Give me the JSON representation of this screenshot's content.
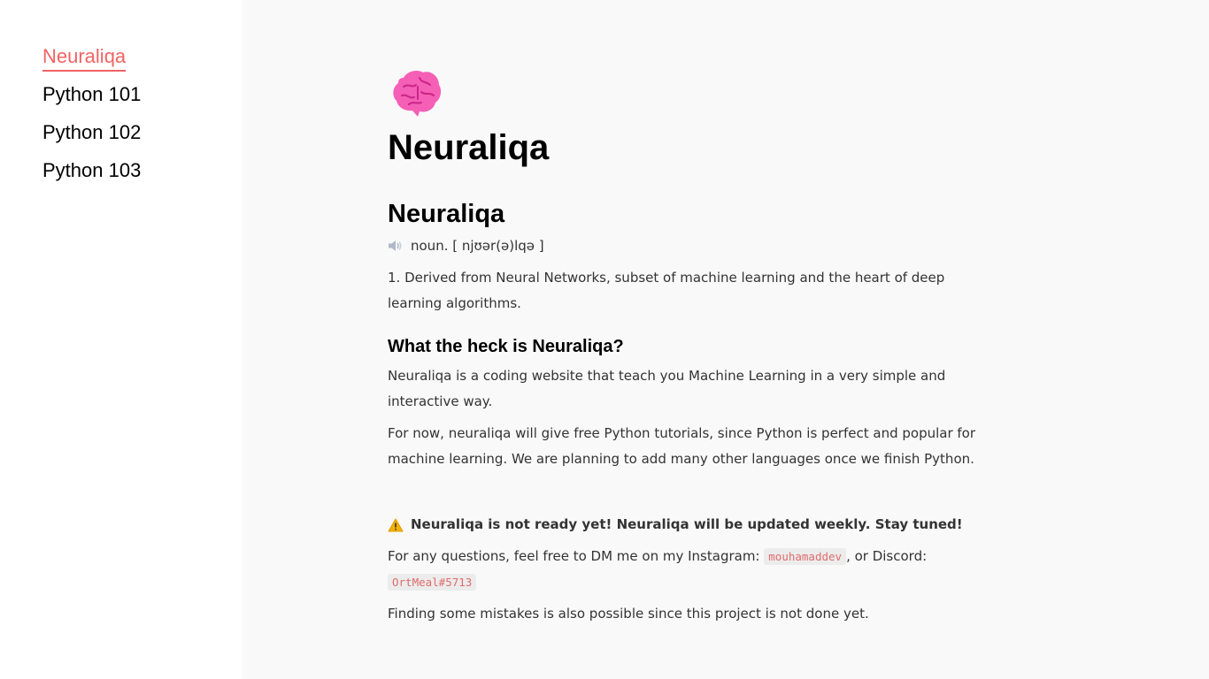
{
  "sidebar": {
    "items": [
      {
        "label": "Neuraliqa",
        "active": true
      },
      {
        "label": "Python 101"
      },
      {
        "label": "Python 102"
      },
      {
        "label": "Python 103"
      }
    ]
  },
  "main": {
    "emoji_icon": "brain-icon",
    "title": "Neuraliqa",
    "subtitle": "Neuraliqa",
    "pronunciation": "noun. [ njʊər(ə)lqə ]",
    "definition": "1. Derived from Neural Networks, subset of machine learning and the heart of deep learning algorithms.",
    "section_heading": "What the heck is Neuraliqa?",
    "paragraph1": "Neuraliqa is a coding website that teach you Machine Learning in a very simple and interactive way.",
    "paragraph2": "For now, neuraliqa will give free Python tutorials, since Python is perfect and popular for machine learning. We are planning to add many other languages once we finish Python.",
    "warning": "Neuraliqa is not ready yet! Neuraliqa will be updated weekly. Stay tuned!",
    "contact_prefix": "For any questions, feel free to DM me on my Instagram: ",
    "instagram": "mouhamaddev",
    "contact_middle": ", or Discord: ",
    "discord": "OrtMeal#5713",
    "paragraph4": "Finding some mistakes is also possible since this project is not done yet."
  },
  "colors": {
    "accent": "#f16363",
    "background": "#f9f9f9",
    "sidebar_bg": "#ffffff"
  }
}
